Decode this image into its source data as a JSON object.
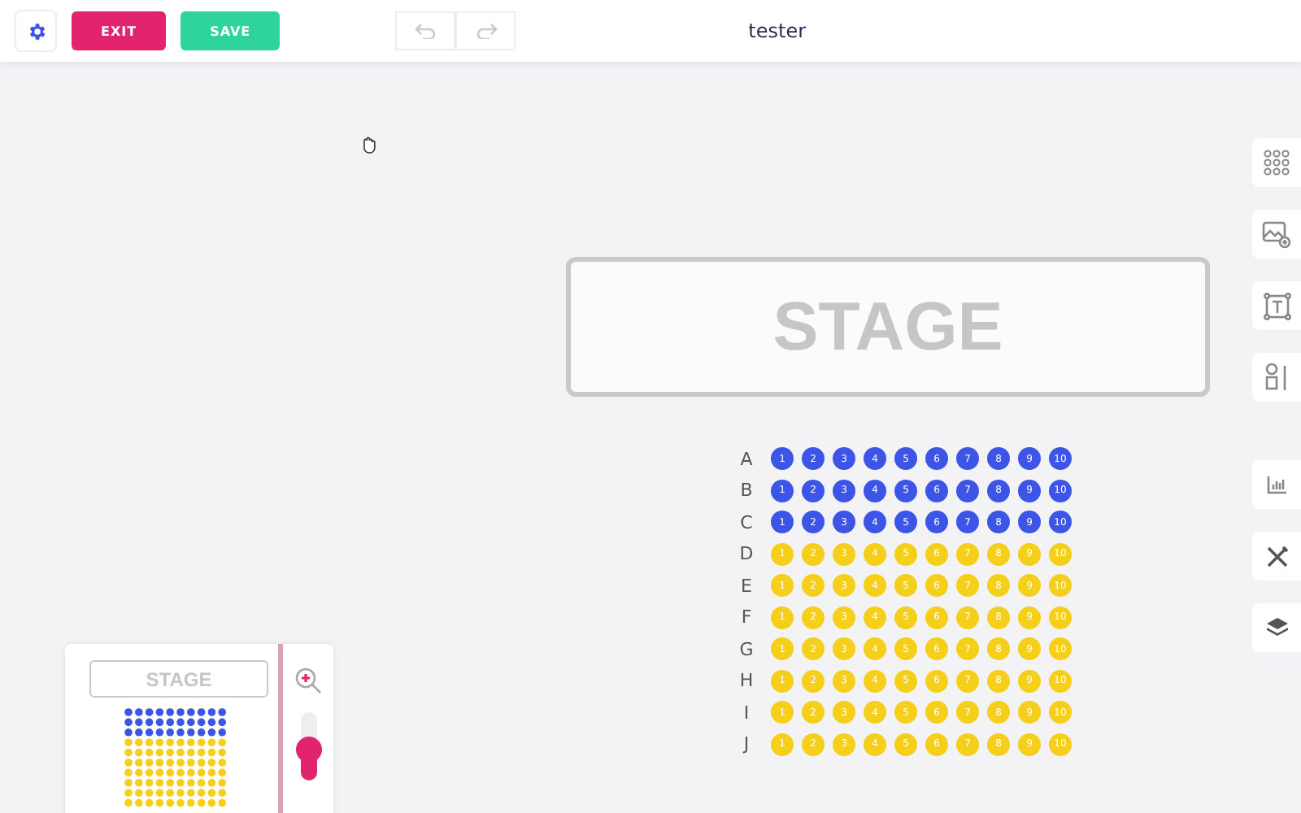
{
  "toolbar": {
    "exit": "EXIT",
    "save": "SAVE",
    "title": "tester"
  },
  "stage": "STAGE",
  "rows": [
    {
      "label": "A",
      "color": "#3d55e6",
      "seats": [
        "1",
        "2",
        "3",
        "4",
        "5",
        "6",
        "7",
        "8",
        "9",
        "10"
      ]
    },
    {
      "label": "B",
      "color": "#3d55e6",
      "seats": [
        "1",
        "2",
        "3",
        "4",
        "5",
        "6",
        "7",
        "8",
        "9",
        "10"
      ]
    },
    {
      "label": "C",
      "color": "#3d55e6",
      "seats": [
        "1",
        "2",
        "3",
        "4",
        "5",
        "6",
        "7",
        "8",
        "9",
        "10"
      ]
    },
    {
      "label": "D",
      "color": "#f5cf1a",
      "seats": [
        "1",
        "2",
        "3",
        "4",
        "5",
        "6",
        "7",
        "8",
        "9",
        "10"
      ]
    },
    {
      "label": "E",
      "color": "#f5cf1a",
      "seats": [
        "1",
        "2",
        "3",
        "4",
        "5",
        "6",
        "7",
        "8",
        "9",
        "10"
      ]
    },
    {
      "label": "F",
      "color": "#f5cf1a",
      "seats": [
        "1",
        "2",
        "3",
        "4",
        "5",
        "6",
        "7",
        "8",
        "9",
        "10"
      ]
    },
    {
      "label": "G",
      "color": "#f5cf1a",
      "seats": [
        "1",
        "2",
        "3",
        "4",
        "5",
        "6",
        "7",
        "8",
        "9",
        "10"
      ]
    },
    {
      "label": "H",
      "color": "#f5cf1a",
      "seats": [
        "1",
        "2",
        "3",
        "4",
        "5",
        "6",
        "7",
        "8",
        "9",
        "10"
      ]
    },
    {
      "label": "I",
      "color": "#f5cf1a",
      "seats": [
        "1",
        "2",
        "3",
        "4",
        "5",
        "6",
        "7",
        "8",
        "9",
        "10"
      ]
    },
    {
      "label": "J",
      "color": "#f5cf1a",
      "seats": [
        "1",
        "2",
        "3",
        "4",
        "5",
        "6",
        "7",
        "8",
        "9",
        "10"
      ]
    }
  ],
  "minimap": {
    "stage": "STAGE",
    "zoom": {
      "level": 0.45
    }
  }
}
